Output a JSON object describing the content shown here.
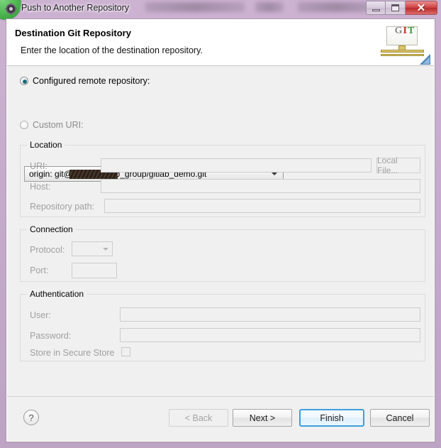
{
  "window": {
    "title": "Push to Another Repository",
    "icon": "git-push-icon",
    "controls": {
      "minimize": "Minimize",
      "maximize": "Maximize",
      "close": "Close"
    }
  },
  "header": {
    "title": "Destination Git Repository",
    "subtitle": "Enter the location of the destination repository.",
    "logo": {
      "letter_g": "G",
      "letter_i": "I",
      "letter_t": "T"
    }
  },
  "source": {
    "configured_label": "Configured remote repository:",
    "configured_selected": true,
    "custom_label": "Custom URI:",
    "custom_selected": false,
    "repository_value": "origin: git@c                 .com:gitlab_group/gitlab_demo.git",
    "repository_prefix": "origin: git@c",
    "repository_suffix": ".com:gitlab_group/gitlab_demo.git"
  },
  "location": {
    "group_title": "Location",
    "uri_label": "URI:",
    "uri_value": "",
    "local_file_button": "Local File...",
    "host_label": "Host:",
    "host_value": "",
    "repository_path_label": "Repository path:",
    "repository_path_value": ""
  },
  "connection": {
    "group_title": "Connection",
    "protocol_label": "Protocol:",
    "protocol_value": "",
    "port_label": "Port:",
    "port_value": ""
  },
  "authentication": {
    "group_title": "Authentication",
    "user_label": "User:",
    "user_value": "",
    "password_label": "Password:",
    "password_value": "",
    "store_secure_label": "Store in Secure Store",
    "store_secure_checked": false
  },
  "buttons": {
    "help": "?",
    "back": "< Back",
    "next": "Next >",
    "finish": "Finish",
    "cancel": "Cancel"
  },
  "colors": {
    "accent_focus": "#3c9fdc",
    "radio_dot": "#1d6a7a",
    "titlebar": "#c6abcc",
    "close_button": "#d04343",
    "client_background": "#f0f0f0",
    "header_background": "#ffffff",
    "disabled_text": "#a0a0a0"
  }
}
